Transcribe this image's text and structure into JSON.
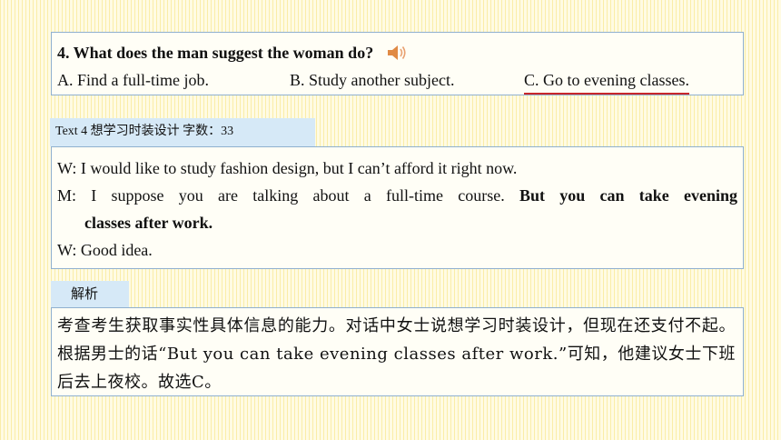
{
  "question": {
    "title": "4. What does the man suggest the woman do?",
    "options": [
      {
        "text": "A. Find a full-time job."
      },
      {
        "text": "B. Study another subject."
      },
      {
        "text": "C. Go to evening classes."
      }
    ],
    "answer_color": "#c8262b",
    "icon": "speaker-icon"
  },
  "text_tab": {
    "label": "Text 4  想学习时装设计   字数：33"
  },
  "dialogue": {
    "line1": "W: I would like to study fashion design, but I can’t afford it right now.",
    "line2_plain": "M: I suppose you are talking about a full-time course. ",
    "line2_bold": "But you can take evening",
    "line3_bold": "classes after work.",
    "line4": "W: Good idea."
  },
  "analysis_tab": {
    "label": "解析"
  },
  "analysis": {
    "text": "考查考生获取事实性具体信息的能力。对话中女士说想学习时装设计，但现在还支付不起。根据男士的话“But you can take evening classes after work.”可知，他建议女士下班后去上夜校。故选C。"
  },
  "colors": {
    "tab_bg": "#d6e9f7",
    "box_border": "#8fb0cf",
    "stripe": "#f6e278"
  }
}
